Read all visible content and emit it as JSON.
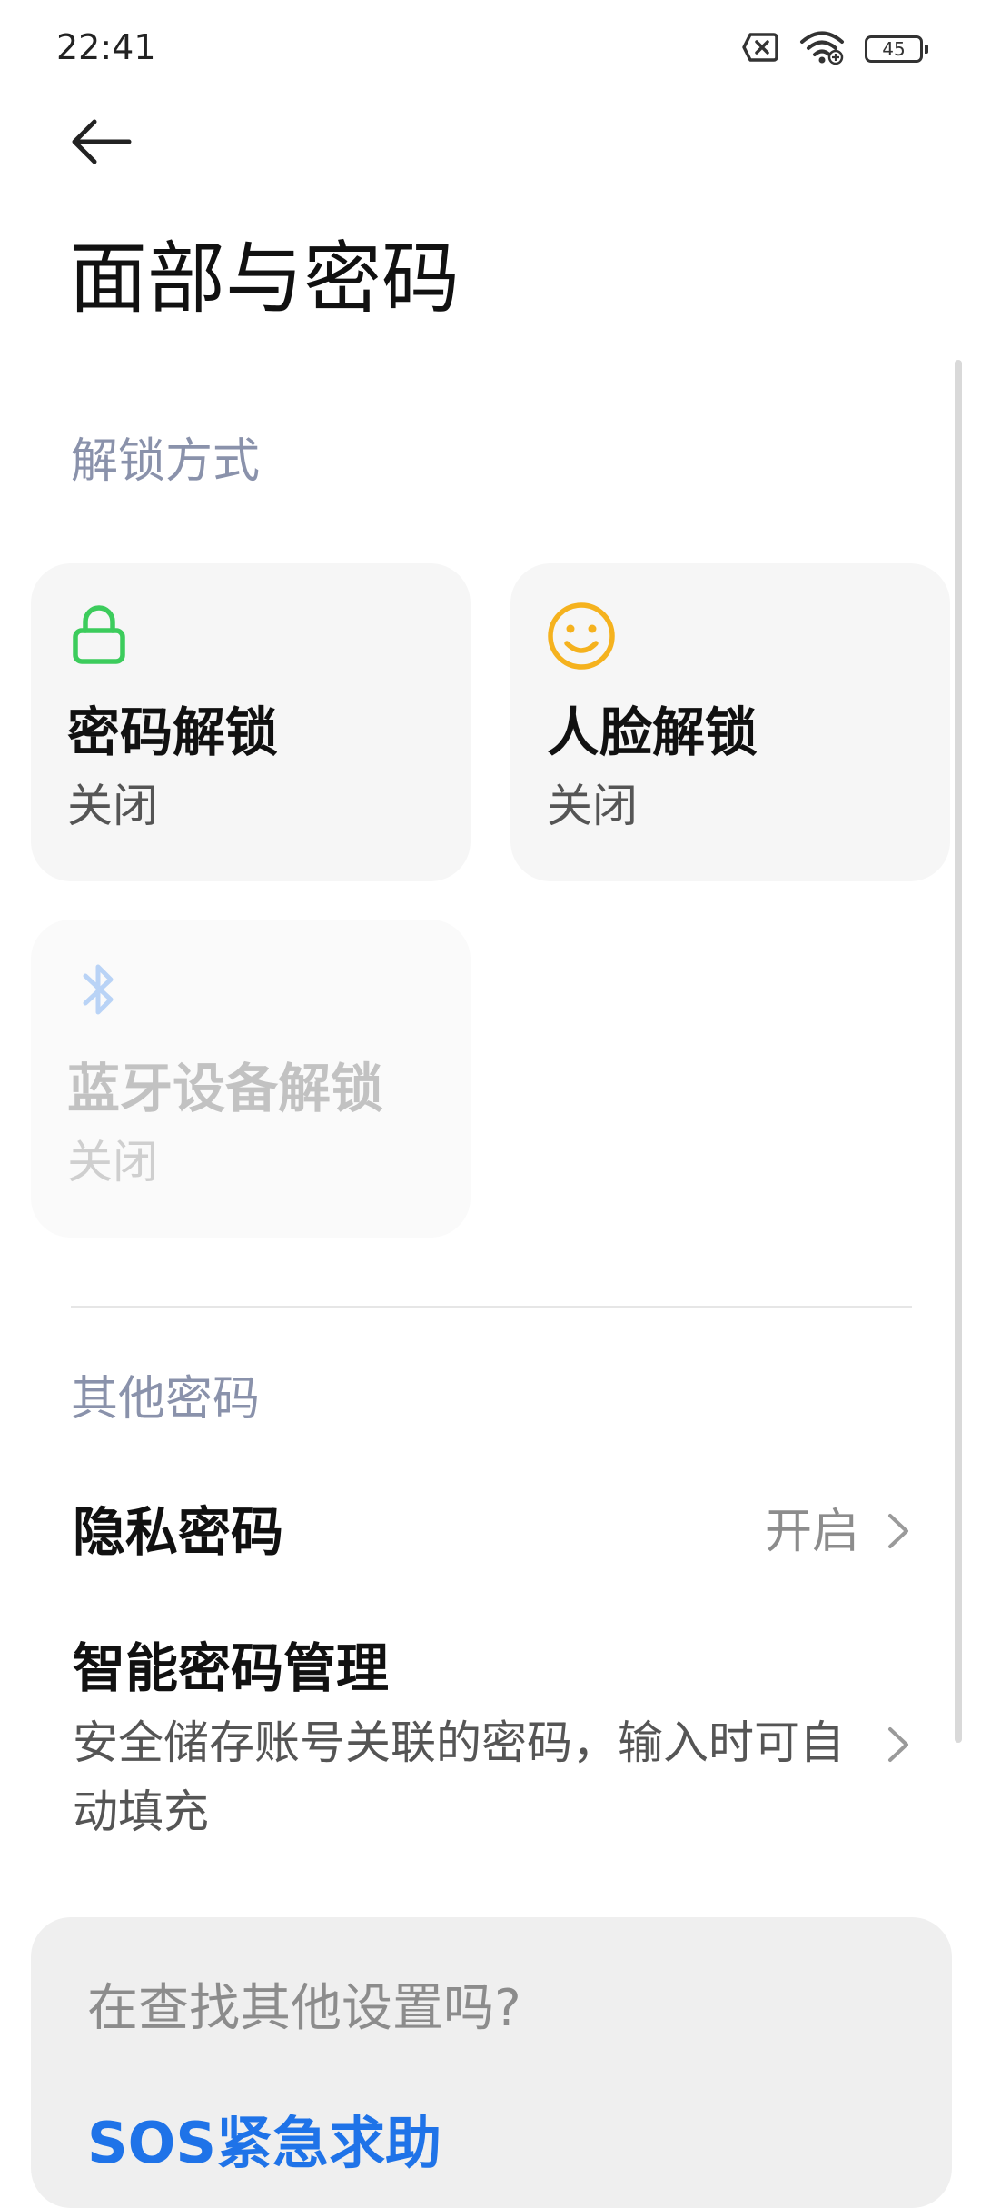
{
  "status_bar": {
    "time": "22:41",
    "icons": [
      "sim-off-icon",
      "wifi-icon",
      "battery-icon"
    ],
    "battery_level": "45"
  },
  "header": {
    "back_icon": "arrow-left-icon",
    "title": "面部与密码"
  },
  "unlock_section": {
    "label": "解锁方式",
    "cards": [
      {
        "icon": "lock-icon",
        "title": "密码解锁",
        "status": "关闭",
        "icon_color": "#3ccc5c"
      },
      {
        "icon": "smiley-face-icon",
        "title": "人脸解锁",
        "status": "关闭",
        "icon_color": "#f5b21e"
      },
      {
        "icon": "bluetooth-icon",
        "title": "蓝牙设备解锁",
        "status": "关闭",
        "icon_color": "#b9d3f6",
        "disabled": true
      }
    ]
  },
  "other_section": {
    "label": "其他密码",
    "items": [
      {
        "title": "隐私密码",
        "value": "开启"
      },
      {
        "title": "智能密码管理",
        "description": "安全储存账号关联的密码，输入时可自动填充"
      }
    ]
  },
  "suggestion": {
    "question": "在查找其他设置吗?",
    "link": "SOS紧急求助",
    "link_color": "#1f73e8"
  }
}
